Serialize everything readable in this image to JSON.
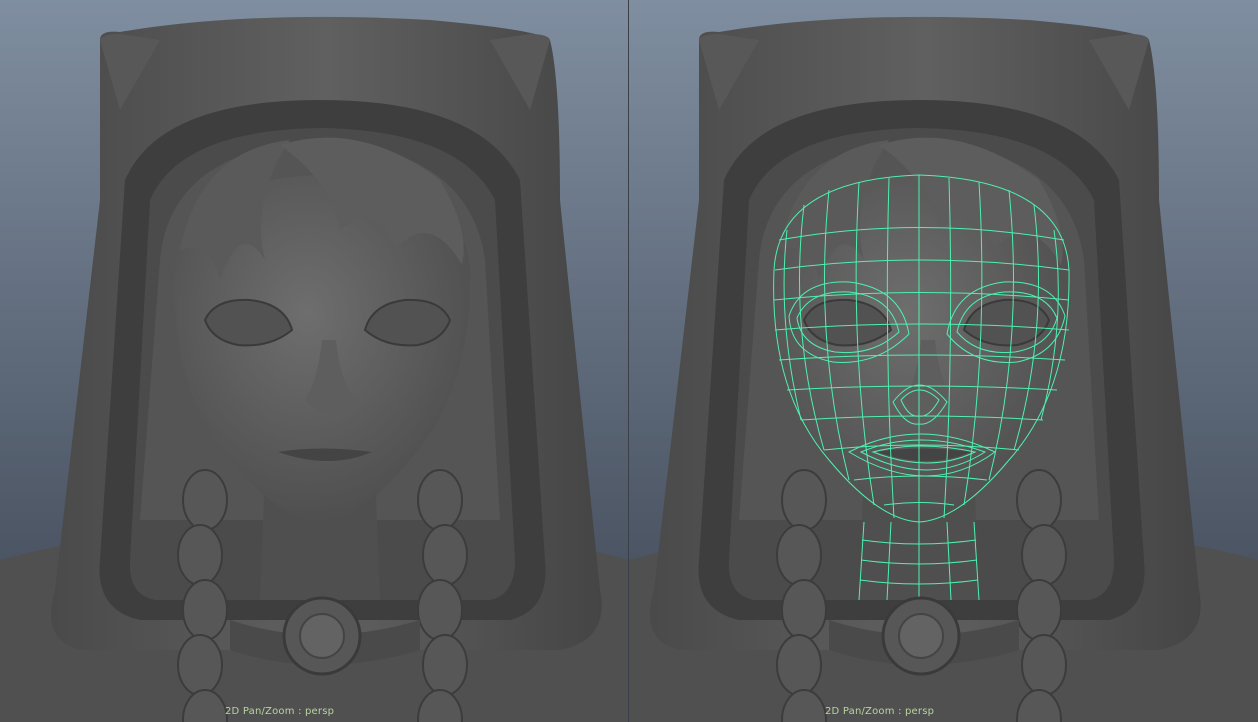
{
  "viewports": {
    "left": {
      "hud_label": "2D Pan/Zoom : persp",
      "show_wireframe": false
    },
    "right": {
      "hud_label": "2D Pan/Zoom : persp",
      "show_wireframe": true
    }
  },
  "colors": {
    "background_top": "#7f8ea0",
    "background_bottom": "#3c4452",
    "mesh_gray": "#5c5c5c",
    "wireframe": "#4ff0b0",
    "hud_text": "#b8d4a0"
  }
}
